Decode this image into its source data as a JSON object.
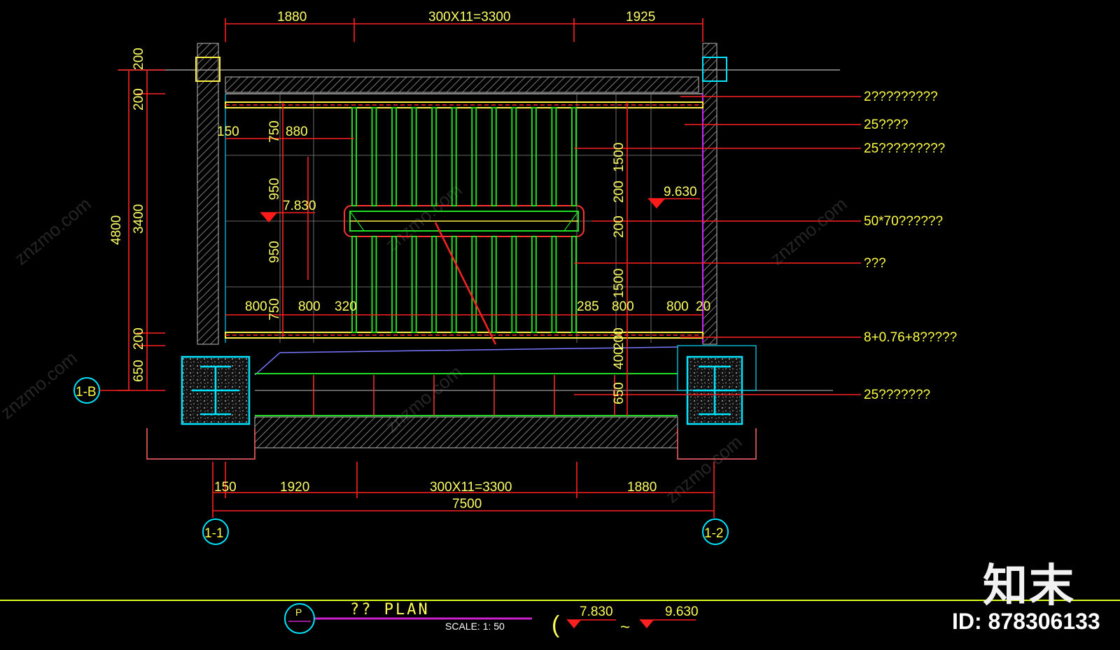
{
  "dimensions": {
    "top": [
      "1880",
      "300X11=3300",
      "1925"
    ],
    "bottom": [
      "150",
      "1920",
      "300X11=3300",
      "1880"
    ],
    "bottom_total": "7500",
    "left_outer": "4800",
    "left_inner": [
      "200",
      "200",
      "3400",
      "200",
      "650"
    ],
    "stair_inner": [
      "150",
      "750",
      "880",
      "950",
      "950",
      "800",
      "750",
      "800",
      "320",
      "285",
      "800",
      "800",
      "20"
    ],
    "right_inner": [
      "1500",
      "200",
      "200",
      "1500",
      "200",
      "400",
      "650"
    ]
  },
  "levels": [
    "7.830",
    "9.630"
  ],
  "notes": [
    "2?????????",
    "25????",
    "25?????????",
    "50*70??????",
    "???",
    "8+0.76+8?????",
    "25???????"
  ],
  "axes": [
    "1-B",
    "1-1",
    "1-2"
  ],
  "title": {
    "symbol": "P",
    "name": "?? PLAN",
    "scale": "SCALE:  1: 50",
    "level_from": "7.830",
    "level_to": "9.630",
    "tilde": "~"
  },
  "watermark": {
    "text": "znzmo.com",
    "logo": "知末",
    "id": "ID: 878306133"
  },
  "colors": {
    "background": "#000000",
    "dimension": "#ff2020",
    "text": "#ffff44",
    "stair": "#22dd22",
    "wall": "#bbbbbb",
    "column": "#00e5ff",
    "title_line": "#cc22cc"
  }
}
